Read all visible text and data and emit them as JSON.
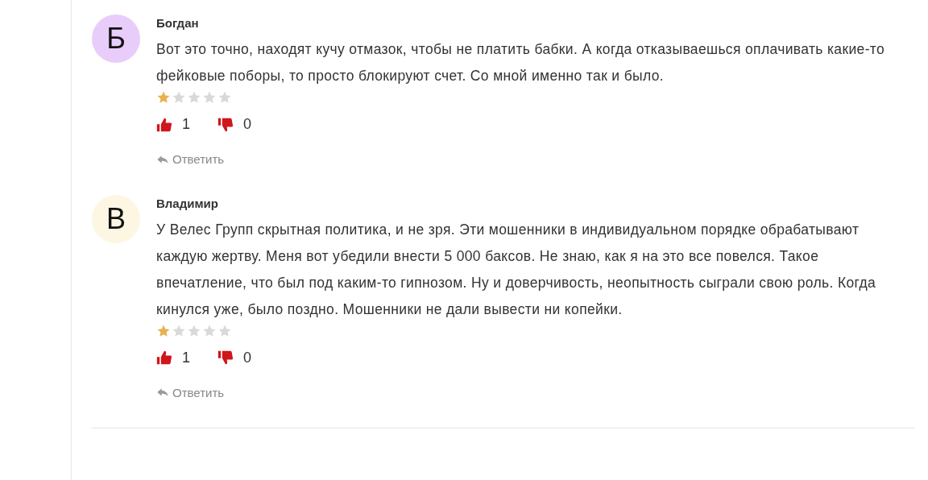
{
  "comments": [
    {
      "author": "Богдан",
      "initial": "Б",
      "color": "#e8cdfb",
      "text": "Вот это точно, находят кучу отмазок, чтобы не платить бабки. А когда отказываешься оплачивать какие-то фейковые поборы, то просто блокируют счет. Со мной именно так и было.",
      "stars": 1,
      "likes": "1",
      "dislikes": "0",
      "reply": "Ответить"
    },
    {
      "author": "Владимир",
      "initial": "В",
      "color": "#fdf6e3",
      "text": "У Велес Групп скрытная политика, и не зря. Эти мошенники в индивидуальном порядке обрабатывают каждую жертву. Меня вот убедили внести 5 000 баксов. Не знаю, как я на это все повелся. Такое впечатление, что был под каким-то гипнозом. Ну и доверчивость, неопытность сыграли свою роль. Когда кинулся уже, было поздно. Мошенники не дали вывести ни копейки.",
      "stars": 1,
      "likes": "1",
      "dislikes": "0",
      "reply": "Ответить"
    }
  ]
}
